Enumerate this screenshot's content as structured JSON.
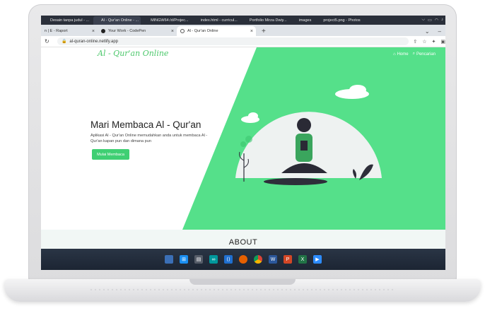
{
  "os_tabs": [
    {
      "label": "Desain tanpa judul - ...",
      "color": "#1ba1e2"
    },
    {
      "label": "Al - Qur'an Online - ...",
      "color": "#e74c3c"
    },
    {
      "label": "MINGW64:/d/Projec...",
      "color": "#f1c40f"
    },
    {
      "label": "index.html - curricul...",
      "color": "#1f8ad2"
    },
    {
      "label": "Portfolio Mirza Dwiy...",
      "color": "#2ecc71"
    },
    {
      "label": "images",
      "color": "#f0c419"
    },
    {
      "label": "project5.png - Photos",
      "color": "#2b88d8"
    }
  ],
  "browser_tabs": [
    {
      "label": "n | E - Raport",
      "active": false
    },
    {
      "label": "Your Work - CodePen",
      "active": false
    },
    {
      "label": "Al - Qur'an Online",
      "active": true
    }
  ],
  "address": {
    "url": "al-quran-online.netlify.app"
  },
  "site": {
    "logo": "Al - Qur'an Online",
    "nav": {
      "home": "Home",
      "search": "Pencarian"
    },
    "hero": {
      "title": "Mari Membaca Al - Qur'an",
      "description": "Aplikasi Al - Qur'an Online memudahkan anda untuk membaca Al - Qur'an kapan pun dan dimana pun",
      "button": "Mulai Membaca"
    },
    "about_title": "ABOUT"
  },
  "colors": {
    "accent": "#3fcf73",
    "hero_green": "#55e08a",
    "taskbar": "#1f2836"
  },
  "taskbar_icons": [
    "widgets-icon",
    "windows-start-icon",
    "task-view-icon",
    "arduino-icon",
    "vscode-icon",
    "firefox-icon",
    "chrome-icon",
    "word-icon",
    "powerpoint-icon",
    "excel-icon",
    "zoom-icon"
  ]
}
